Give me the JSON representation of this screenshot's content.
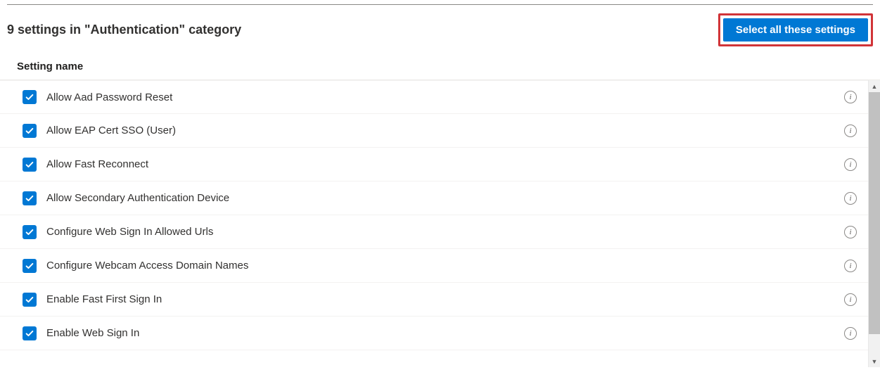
{
  "header": {
    "category_summary": "9 settings in \"Authentication\" category",
    "select_all_label": "Select all these settings"
  },
  "table": {
    "column_header": "Setting name"
  },
  "settings": [
    {
      "label": "Allow Aad Password Reset",
      "checked": true
    },
    {
      "label": "Allow EAP Cert SSO (User)",
      "checked": true
    },
    {
      "label": "Allow Fast Reconnect",
      "checked": true
    },
    {
      "label": "Allow Secondary Authentication Device",
      "checked": true
    },
    {
      "label": "Configure Web Sign In Allowed Urls",
      "checked": true
    },
    {
      "label": "Configure Webcam Access Domain Names",
      "checked": true
    },
    {
      "label": "Enable Fast First Sign In",
      "checked": true
    },
    {
      "label": "Enable Web Sign In",
      "checked": true
    }
  ],
  "info_glyph": "i"
}
